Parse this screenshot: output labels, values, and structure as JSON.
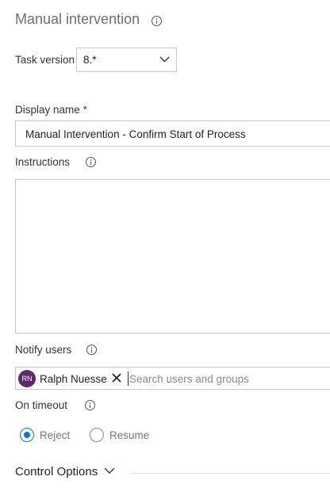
{
  "panel": {
    "title": "Manual intervention"
  },
  "task_version": {
    "label": "Task version",
    "value": "8.*"
  },
  "display_name": {
    "label": "Display name",
    "required_marker": "*",
    "value": "Manual Intervention - Confirm Start of Process"
  },
  "instructions": {
    "label": "Instructions",
    "value": ""
  },
  "notify_users": {
    "label": "Notify users",
    "selected": [
      {
        "initials": "RN",
        "name": "Ralph Nuesse",
        "avatar_color": "#5b2a6e"
      }
    ],
    "placeholder": "Search users and groups"
  },
  "on_timeout": {
    "label": "On timeout",
    "options": [
      {
        "label": "Reject",
        "checked": true
      },
      {
        "label": "Resume",
        "checked": false
      }
    ]
  },
  "control_options": {
    "label": "Control Options"
  },
  "colors": {
    "accent": "#0078d4",
    "required": "#a4262c"
  }
}
